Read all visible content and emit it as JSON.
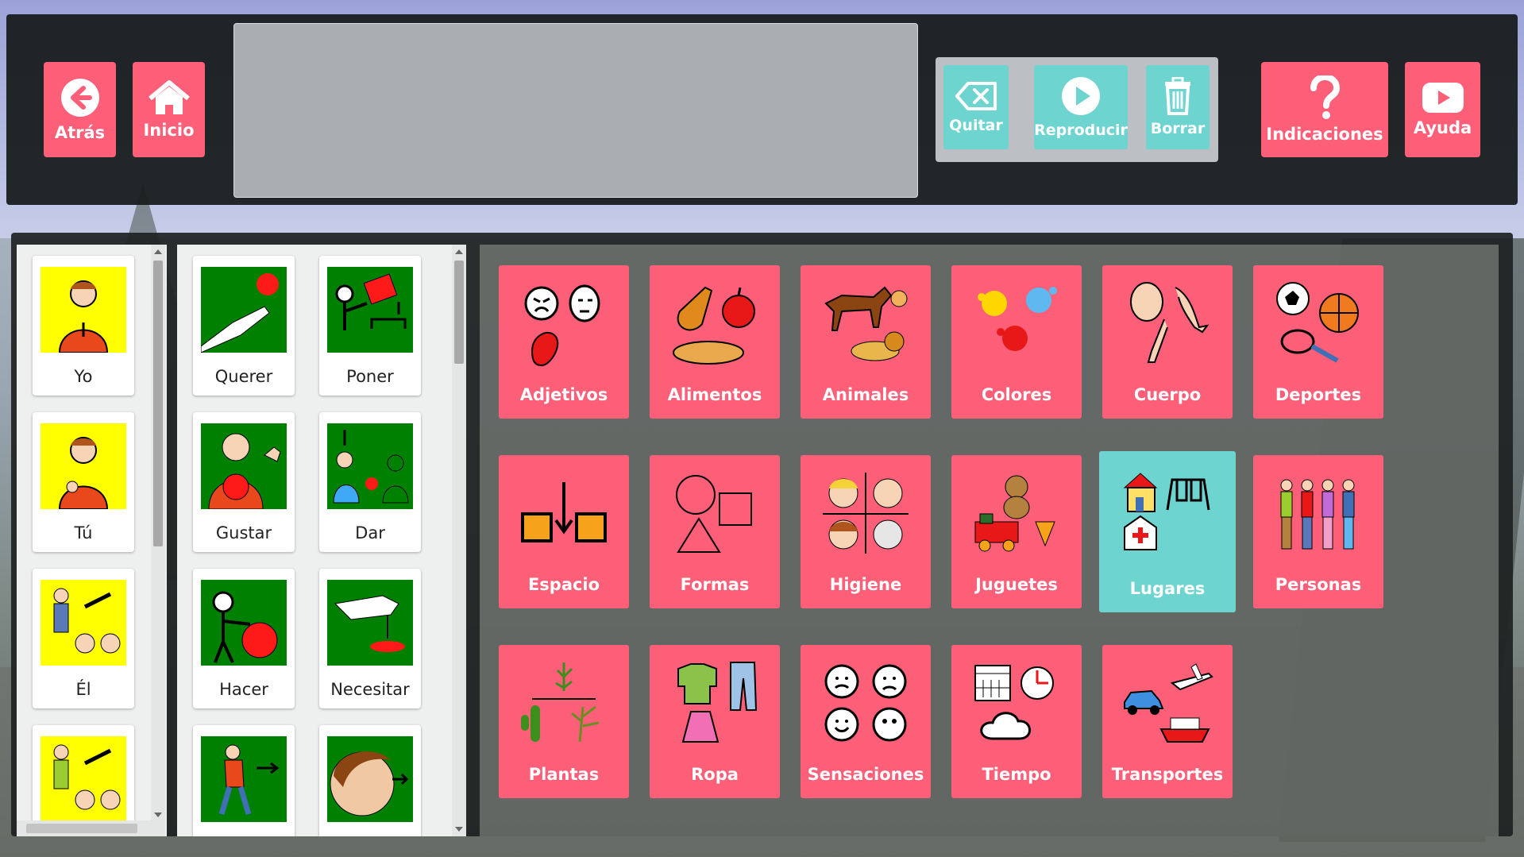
{
  "header": {
    "back_label": "Atrás",
    "home_label": "Inicio",
    "remove_label": "Quitar",
    "play_label": "Reproducir",
    "clear_label": "Borrar",
    "instructions_label": "Indicaciones",
    "help_label": "Ayuda"
  },
  "pronouns": [
    {
      "label": "Yo"
    },
    {
      "label": "Tú"
    },
    {
      "label": "Él"
    },
    {
      "label": ""
    }
  ],
  "verbs": [
    {
      "label": "Querer"
    },
    {
      "label": "Poner"
    },
    {
      "label": "Gustar"
    },
    {
      "label": "Dar"
    },
    {
      "label": "Hacer"
    },
    {
      "label": "Necesitar"
    },
    {
      "label": ""
    },
    {
      "label": ""
    }
  ],
  "categories": [
    {
      "label": "Adjetivos",
      "icon": "faces-icon"
    },
    {
      "label": "Alimentos",
      "icon": "food-icon"
    },
    {
      "label": "Animales",
      "icon": "animals-icon"
    },
    {
      "label": "Colores",
      "icon": "paint-splash-icon"
    },
    {
      "label": "Cuerpo",
      "icon": "body-icon"
    },
    {
      "label": "Deportes",
      "icon": "balls-icon"
    },
    {
      "label": "Espacio",
      "icon": "position-icon"
    },
    {
      "label": "Formas",
      "icon": "shapes-icon"
    },
    {
      "label": "Higiene",
      "icon": "hygiene-icon"
    },
    {
      "label": "Juguetes",
      "icon": "toys-icon"
    },
    {
      "label": "Lugares",
      "icon": "places-icon"
    },
    {
      "label": "Personas",
      "icon": "people-icon"
    },
    {
      "label": "Plantas",
      "icon": "plants-icon"
    },
    {
      "label": "Ropa",
      "icon": "clothes-icon"
    },
    {
      "label": "Sensaciones",
      "icon": "feelings-icon"
    },
    {
      "label": "Tiempo",
      "icon": "weather-icon"
    },
    {
      "label": "Transportes",
      "icon": "transport-icon"
    }
  ],
  "colors": {
    "accent_pink": "#fd5f78",
    "accent_teal": "#6ed4d0",
    "pronoun_bg": "#ffff00",
    "verb_bg": "#008000"
  }
}
